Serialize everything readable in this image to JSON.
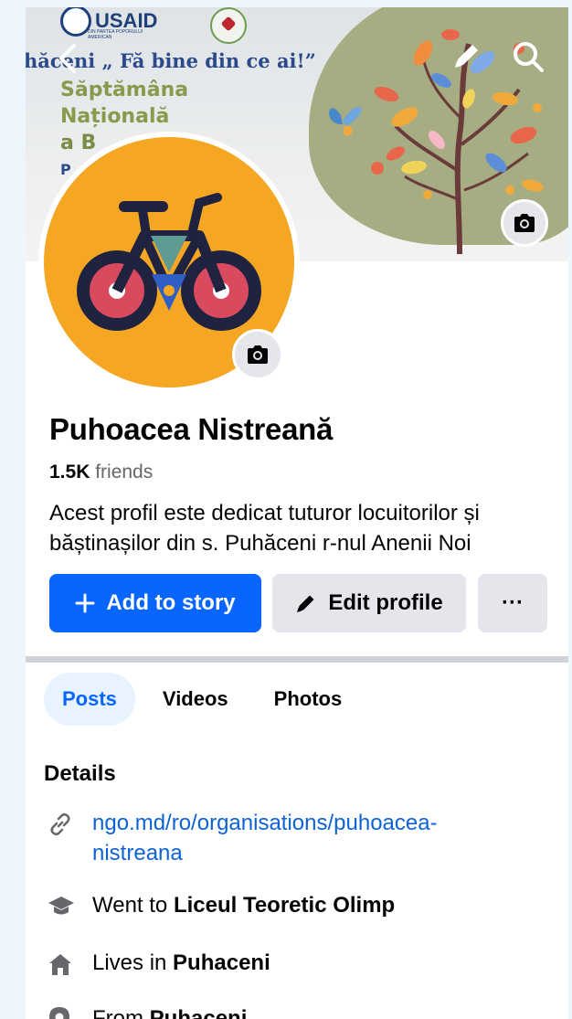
{
  "cover": {
    "logo_usaid": "USAID",
    "logo_usaid_sub": "DIN PARTEA POPORULUI AMERICAN",
    "slogan": "hăceni „ Fă bine din ce ai!”",
    "campaign_lines": [
      "Săptămâna",
      "Națională",
      "a B"
    ],
    "campaign_extra": "P"
  },
  "profile": {
    "name": "Puhoacea Nistreană",
    "friends_count": "1.5K",
    "friends_label": "friends",
    "bio": "Acest profil este dedicat tuturor locuitorilor și băștinașilor din s. Puhăceni r-nul Anenii Noi"
  },
  "actions": {
    "add_story": "Add to story",
    "edit_profile": "Edit profile",
    "more": "···"
  },
  "tabs": [
    {
      "label": "Posts",
      "active": true
    },
    {
      "label": "Videos",
      "active": false
    },
    {
      "label": "Photos",
      "active": false
    }
  ],
  "details": {
    "title": "Details",
    "link": "ngo.md/ro/organisations/puhoacea-nistreana",
    "education_prefix": "Went to",
    "education": "Liceul Teoretic Olimp",
    "lives_prefix": "Lives in",
    "lives": "Puhaceni",
    "from_prefix": "From",
    "from": "Puhaceni"
  },
  "colors": {
    "primary": "#0866ff",
    "link": "#0d63d6",
    "avatar_bg": "#f5a623",
    "active_tab_bg": "#e7f3ff"
  },
  "icons": [
    "back-arrow-icon",
    "pencil-icon",
    "search-icon",
    "camera-icon",
    "plus-icon",
    "link-icon",
    "graduation-cap-icon",
    "home-icon",
    "location-pin-icon"
  ]
}
